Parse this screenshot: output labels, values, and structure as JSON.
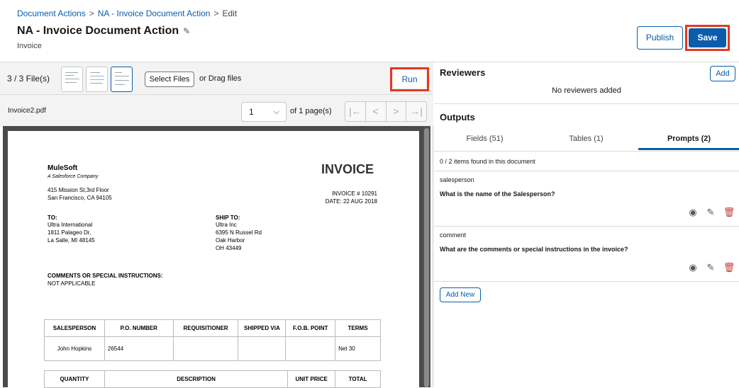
{
  "breadcrumb": {
    "items": [
      "Document Actions",
      "NA - Invoice Document Action"
    ],
    "current": "Edit",
    "separator": ">"
  },
  "header": {
    "title": "NA - Invoice Document Action",
    "subtitle": "Invoice",
    "publish_label": "Publish",
    "save_label": "Save"
  },
  "files": {
    "count_label": "3 / 3 File(s)",
    "select_label": "Select Files",
    "drag_label": "or Drag files",
    "run_label": "Run",
    "filename": "Invoice2.pdf"
  },
  "pager": {
    "page_value": "1",
    "of_pages": "of 1 page(s)",
    "nav": [
      "|←",
      "<",
      ">",
      "→|"
    ]
  },
  "invoice": {
    "company": "MuleSoft",
    "tagline": "A Salesforce Company",
    "addr1": "415 Mission St,3rd Floor",
    "addr2": "San Francisco, CA 94105",
    "title": "INVOICE",
    "number": "INVOICE # 10291",
    "date": "DATE: 22 AUG 2018",
    "to_label": "TO:",
    "to_lines": [
      "Ultra International",
      "1811 Palageo Dr,",
      "La Salle, MI 48145"
    ],
    "ship_label": "SHIP TO:",
    "ship_lines": [
      "Ultra Inc",
      "6395 N Russel Rd",
      "Oak Harbor",
      "OH 43449"
    ],
    "comments_label": "COMMENTS OR SPECIAL INSTRUCTIONS:",
    "comments_value": "NOT APPLICABLE",
    "table_headers": [
      "SALESPERSON",
      "P.O. NUMBER",
      "REQUISITIONER",
      "SHIPPED VIA",
      "F.O.B. POINT",
      "TERMS"
    ],
    "table_row": [
      "John Hopkins",
      "26544",
      "",
      "",
      "",
      "Net 30"
    ],
    "table2_headers": [
      "QUANTITY",
      "DESCRIPTION",
      "UNIT PRICE",
      "TOTAL"
    ]
  },
  "reviewers": {
    "title": "Reviewers",
    "add_label": "Add",
    "empty_text": "No reviewers added"
  },
  "outputs": {
    "title": "Outputs",
    "tabs": [
      "Fields (51)",
      "Tables (1)",
      "Prompts (2)"
    ],
    "active_tab": 2,
    "found_text": "0 / 2 items found in this document",
    "prompts": [
      {
        "name": "salesperson",
        "question": "What is the name of the Salesperson?"
      },
      {
        "name": "comment",
        "question": "What are the comments or special instructions in the invoice?"
      }
    ],
    "add_new_label": "Add New"
  },
  "colors": {
    "accent": "#0b5cab",
    "highlight": "#e2391f",
    "delete": "#c23934"
  },
  "icons": [
    "pencil-icon",
    "chevron-down-icon",
    "first-page-icon",
    "prev-page-icon",
    "next-page-icon",
    "last-page-icon",
    "eye-icon",
    "edit-icon",
    "trash-icon"
  ]
}
